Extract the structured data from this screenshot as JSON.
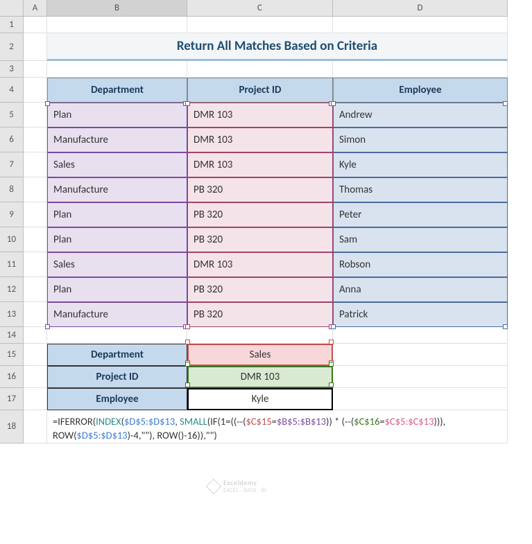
{
  "columns": [
    "A",
    "B",
    "C",
    "D"
  ],
  "rows": [
    "1",
    "2",
    "3",
    "4",
    "5",
    "6",
    "7",
    "8",
    "9",
    "10",
    "11",
    "12",
    "13",
    "14",
    "15",
    "16",
    "17",
    "18"
  ],
  "title": "Return All Matches Based on Criteria",
  "headers": {
    "b": "Department",
    "c": "Project ID",
    "d": "Employee"
  },
  "data": [
    {
      "b": "Plan",
      "c": "DMR 103",
      "d": "Andrew"
    },
    {
      "b": "Manufacture",
      "c": "DMR 103",
      "d": "Simon"
    },
    {
      "b": "Sales",
      "c": "DMR 103",
      "d": "Kyle"
    },
    {
      "b": "Manufacture",
      "c": "PB 320",
      "d": "Thomas"
    },
    {
      "b": "Plan",
      "c": "PB 320",
      "d": "Peter"
    },
    {
      "b": "Plan",
      "c": "PB 320",
      "d": "Sam"
    },
    {
      "b": "Sales",
      "c": "DMR 103",
      "d": "Robson"
    },
    {
      "b": "Plan",
      "c": "PB 320",
      "d": "Anna"
    },
    {
      "b": "Manufacture",
      "c": "PB 320",
      "d": "Patrick"
    }
  ],
  "criteria": {
    "dept_label": "Department",
    "dept_value": "Sales",
    "proj_label": "Project ID",
    "proj_value": "DMR 103",
    "emp_label": "Employee",
    "emp_value": "Kyle"
  },
  "formula": {
    "p1": "=IFERROR(",
    "p2": "INDEX",
    "p3": "(",
    "p4": "$D$5:$D$13",
    "p5": ", ",
    "p6": "SMALL",
    "p7": "(",
    "p8": "IF",
    "p9": "(1=((--(",
    "p10": "$C$15",
    "p11": "=",
    "p12": "$B$5:$B$13",
    "p13": ")) * (--(",
    "p14": "$C$16",
    "p15": "=",
    "p16": "$C$5:$C$13",
    "p17": "))), ",
    "p18": "ROW",
    "p19": "(",
    "p20": "$D$5:$D$13",
    "p21": ")-4,\"\"), ",
    "p22": "ROW",
    "p23": "()-16)),\"\")"
  },
  "watermark": {
    "brand": "Exceldemy",
    "sub": "EXCEL · DATA · BI"
  }
}
